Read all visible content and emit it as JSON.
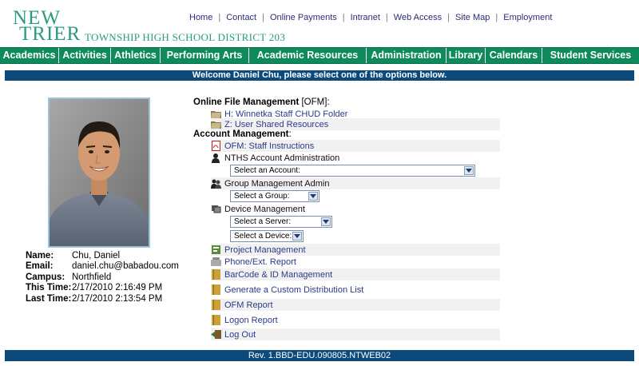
{
  "logo": {
    "new": "NEW",
    "trier": "TRIER",
    "district": "TOWNSHIP HIGH SCHOOL DISTRICT 203"
  },
  "top_links": [
    "Home",
    "Contact",
    "Online Payments",
    "Intranet",
    "Web Access",
    "Site Map",
    "Employment"
  ],
  "nav": [
    "Academics",
    "Activities",
    "Athletics",
    "Performing Arts",
    "Academic Resources",
    "Administration",
    "Library",
    "Calendars",
    "Student Services"
  ],
  "welcome": "Welcome Daniel Chu, please select one of the options below.",
  "user": {
    "name_label": "Name:",
    "name": "Chu, Daniel",
    "email_label": "Email:",
    "email": "daniel.chu@babadou.com",
    "campus_label": "Campus:",
    "campus": "Northfield",
    "this_time_label": "This Time:",
    "this_time": "2/17/2010 2:16:49 PM",
    "last_time_label": "Last Time:",
    "last_time": "2/17/2010 2:13:54 PM"
  },
  "ofm": {
    "title": "Online File Management",
    "tag": "[OFM]",
    "colon": ":",
    "items": [
      "H: Winnetka Staff CHUD Folder",
      "Z: User Shared Resources"
    ]
  },
  "account": {
    "title": "Account Management",
    "colon": ":",
    "staff_instructions": "OFM: Staff Instructions",
    "nths_admin": "NTHS Account Administration",
    "select_account": "Select an Account:",
    "group_admin": "Group Management Admin",
    "select_group": "Select a Group:",
    "device_mgmt": "Device Management",
    "select_server": "Select a Server:",
    "select_device": "Select a Device:",
    "project_mgmt": "Project Management",
    "phone_report": "Phone/Ext. Report",
    "barcode": "BarCode & ID Management",
    "distribution": "Generate a Custom Distribution List",
    "ofm_report": "OFM Report",
    "logon_report": "Logon Report",
    "logout": "Log Out"
  },
  "footer": "Rev. 1.BBD-EDU.090805.NTWEB02",
  "colors": {
    "logo_green": "#2a9a7e",
    "nav_green": "#0f8a5a",
    "bar_blue": "#0d4a7c",
    "link_blue": "#2c3a8a"
  }
}
